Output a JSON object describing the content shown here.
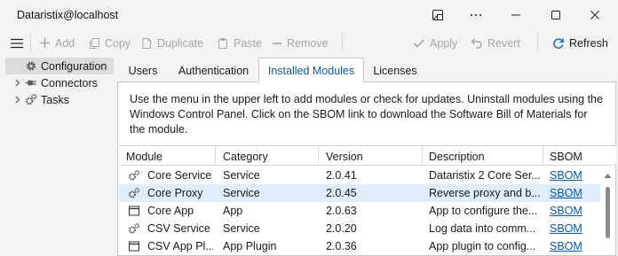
{
  "window": {
    "title": "Dataristix@localhost"
  },
  "toolbar": {
    "add": "Add",
    "copy": "Copy",
    "duplicate": "Duplicate",
    "paste": "Paste",
    "remove": "Remove",
    "apply": "Apply",
    "revert": "Revert",
    "refresh": "Refresh"
  },
  "tree": {
    "items": [
      {
        "label": "Configuration",
        "icon": "gear-icon",
        "selected": true
      },
      {
        "label": "Connectors",
        "icon": "plug-icon",
        "selected": false
      },
      {
        "label": "Tasks",
        "icon": "gears-icon",
        "selected": false
      }
    ]
  },
  "tabs": [
    {
      "label": "Users",
      "active": false
    },
    {
      "label": "Authentication",
      "active": false
    },
    {
      "label": "Installed Modules",
      "active": true
    },
    {
      "label": "Licenses",
      "active": false
    }
  ],
  "panel": {
    "description": "Use the menu in the upper left to add modules or check for updates. Uninstall modules using the Windows Control Panel. Click on the SBOM link to download the Software Bill of Materials for the module."
  },
  "grid": {
    "columns": [
      "Module",
      "Category",
      "Version",
      "Description",
      "SBOM"
    ],
    "rows": [
      {
        "icon": "gears-icon",
        "module": "Core Service",
        "category": "Service",
        "version": "2.0.41",
        "description": "Dataristix 2 Core Ser...",
        "sbom": "SBOM",
        "selected": false
      },
      {
        "icon": "gears-icon",
        "module": "Core Proxy",
        "category": "Service",
        "version": "2.0.45",
        "description": "Reverse proxy and b...",
        "sbom": "SBOM",
        "selected": true
      },
      {
        "icon": "window-icon",
        "module": "Core App",
        "category": "App",
        "version": "2.0.63",
        "description": "App to configure the...",
        "sbom": "SBOM",
        "selected": false
      },
      {
        "icon": "gears-icon",
        "module": "CSV Service",
        "category": "Service",
        "version": "2.0.20",
        "description": "Log data into comm...",
        "sbom": "SBOM",
        "selected": false
      },
      {
        "icon": "window-icon",
        "module": "CSV App Pl...",
        "category": "App Plugin",
        "version": "2.0.36",
        "description": "App plugin to config...",
        "sbom": "SBOM",
        "selected": false
      }
    ]
  },
  "colors": {
    "accent": "#0a5aa8",
    "selected_row": "#dfecf9",
    "tree_selected": "#dcdcdc",
    "disabled_text": "#a6a6a6"
  }
}
